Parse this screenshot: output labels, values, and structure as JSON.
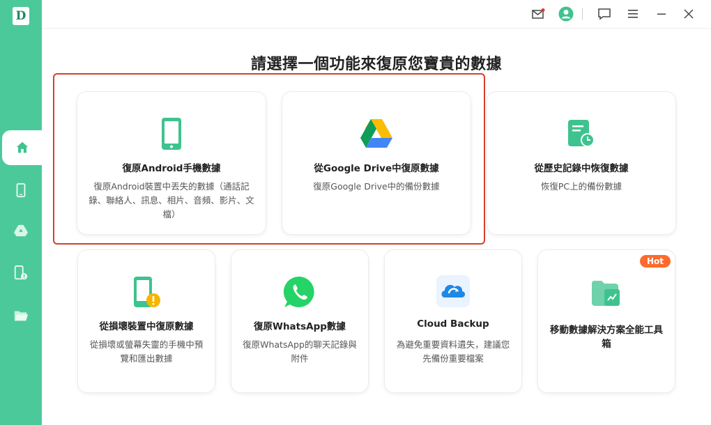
{
  "sidebar": {
    "logo": "D",
    "items": [
      {
        "name": "home",
        "icon": "home-icon",
        "active": true
      },
      {
        "name": "device",
        "icon": "phone-icon",
        "active": false
      },
      {
        "name": "google-drive",
        "icon": "drive-icon",
        "active": false
      },
      {
        "name": "broken-device",
        "icon": "broken-phone-icon",
        "active": false
      },
      {
        "name": "folder",
        "icon": "folder-icon",
        "active": false
      }
    ]
  },
  "topbar": {
    "icons": [
      "mail-icon",
      "user-icon",
      "feedback-icon",
      "menu-icon",
      "minimize-icon",
      "close-icon"
    ]
  },
  "main": {
    "title": "請選擇一個功能來復原您寶貴的數據",
    "cards_top": [
      {
        "title": "復原Android手機數據",
        "desc": "復原Android裝置中丟失的數據（通話記錄、聯絡人、訊息、相片、音頻、影片、文檔）",
        "icon": "phone-icon"
      },
      {
        "title": "從Google Drive中復原數據",
        "desc": "復原Google Drive中的備份數據",
        "icon": "google-drive-icon"
      },
      {
        "title": "從歷史記錄中恢復數據",
        "desc": "恢復PC上的備份數據",
        "icon": "history-document-icon"
      }
    ],
    "cards_bottom": [
      {
        "title": "從損壞裝置中復原數據",
        "desc": "從損壞或螢幕失靈的手機中預覽和匯出數據",
        "icon": "broken-phone-icon"
      },
      {
        "title": "復原WhatsApp數據",
        "desc": "復原WhatsApp的聊天記錄與附件",
        "icon": "whatsapp-icon"
      },
      {
        "title": "Cloud Backup",
        "desc": "為避免重要資料遺失，建議您先備份重要檔案",
        "icon": "cloud-backup-icon"
      },
      {
        "title": "移動數據解決方案全能工具箱",
        "desc": "",
        "icon": "toolbox-icon",
        "badge": "Hot"
      }
    ]
  },
  "colors": {
    "sidebar": "#4cc99a",
    "accent_green": "#3fc38e",
    "highlight_border": "#d6402a",
    "hot_badge": "#ff6a2c"
  }
}
